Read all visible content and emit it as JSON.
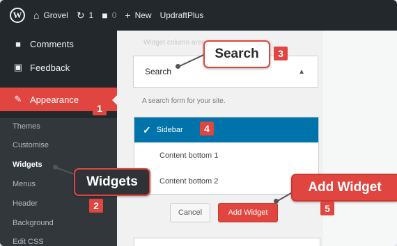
{
  "adminbar": {
    "site_name": "Grovel",
    "updates_count": "1",
    "comments_count": "0",
    "new_label": "New",
    "plugin_label": "UpdraftPlus"
  },
  "sidebar": {
    "comments": "Comments",
    "feedback": "Feedback",
    "appearance": "Appearance",
    "submenu": [
      "Themes",
      "Customise",
      "Widgets",
      "Menus",
      "Header",
      "Background",
      "Edit CSS"
    ]
  },
  "main": {
    "faded_header": "Widget column area",
    "box_title": "Search",
    "description": "A search form for your site.",
    "areas": [
      "Sidebar",
      "Content bottom 1",
      "Content bottom 2"
    ],
    "cancel": "Cancel",
    "add_widget": "Add Widget"
  },
  "callouts": {
    "search": "Search",
    "widgets": "Widgets",
    "add_widget": "Add Widget",
    "badges": [
      "1",
      "2",
      "3",
      "4",
      "5"
    ]
  },
  "colors": {
    "accent": "#e0463f",
    "selected": "#0073aa",
    "adminbar": "#23282d"
  }
}
